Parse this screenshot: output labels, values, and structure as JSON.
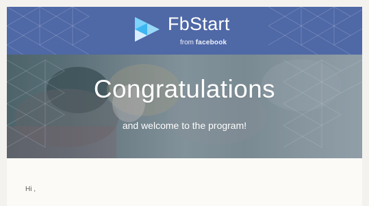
{
  "email": {
    "brand": {
      "name": "FbStart",
      "from_prefix": "from",
      "from_company": "facebook",
      "accent_color": "#4f68a6"
    },
    "hero": {
      "title": "Congratulations",
      "subtitle": "and welcome to the program!"
    },
    "body": {
      "greeting": "Hi ,"
    }
  }
}
